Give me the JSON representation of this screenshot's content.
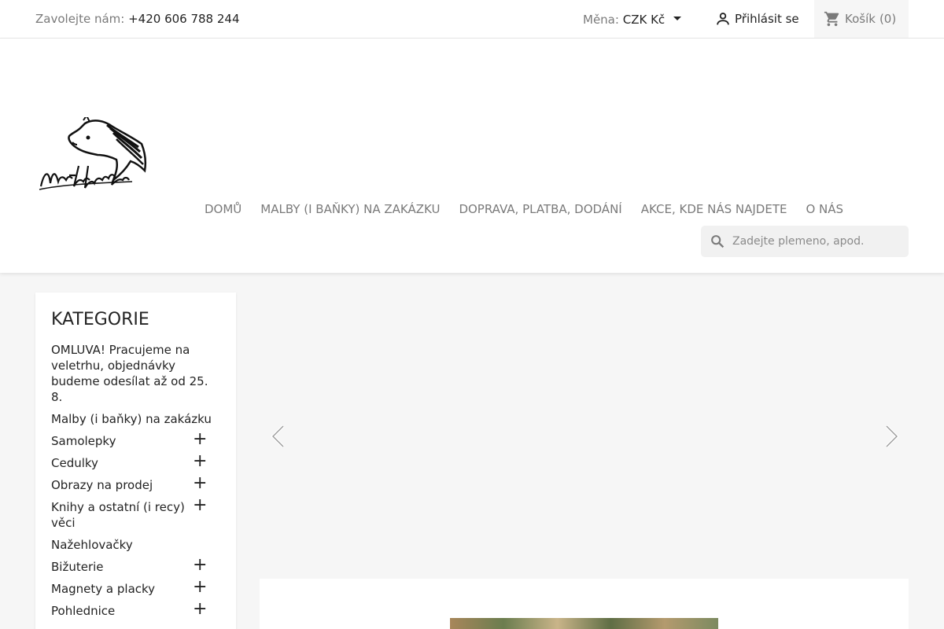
{
  "topbar": {
    "contact_label": "Zavolejte nám:",
    "phone": "+420 606 788 244",
    "currency_label": "Měna:",
    "currency_value": "CZK Kč",
    "login_label": "Přihlásit se",
    "cart_label": "Košík",
    "cart_count": "(0)"
  },
  "nav": {
    "items": [
      {
        "label": "Domů"
      },
      {
        "label": "Malby (i baňky) na zakázku"
      },
      {
        "label": "Doprava, platba, dodání"
      },
      {
        "label": "Akce, kde nás najdete"
      },
      {
        "label": "O nás"
      }
    ]
  },
  "search": {
    "placeholder": "Zadejte plemeno, apod."
  },
  "sidebar": {
    "title": "KATEGORIE",
    "items": [
      {
        "label": "OMLUVA! Pracujeme na veletrhu, objednávky budeme odesílat až od 25. 8."
      },
      {
        "label": "Malby (i baňky) na zakázku"
      },
      {
        "label": "Samolepky"
      },
      {
        "label": "Cedulky"
      },
      {
        "label": "Obrazy na prodej"
      },
      {
        "label": "Knihy a ostatní (i recy) věci"
      },
      {
        "label": "Nažehlovačky"
      },
      {
        "label": "Bižuterie"
      },
      {
        "label": "Magnety a placky"
      },
      {
        "label": "Pohlednice"
      }
    ],
    "expand_symbol": "+"
  },
  "icons": {
    "user": "user-icon",
    "cart": "cart-icon",
    "search": "search-icon",
    "prev": "chevron-left-icon",
    "next": "chevron-right-icon"
  },
  "colors": {
    "text": "#232323",
    "muted": "#7a7a7a",
    "background": "#f6f6f6"
  }
}
